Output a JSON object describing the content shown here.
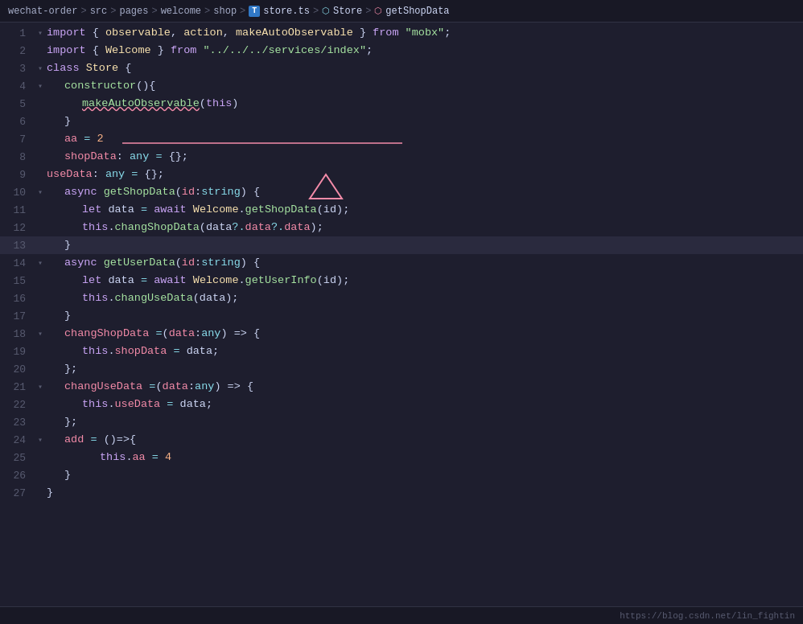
{
  "breadcrumb": {
    "parts": [
      {
        "label": "wechat-order",
        "type": "folder"
      },
      {
        "label": ">",
        "type": "sep"
      },
      {
        "label": "src",
        "type": "folder"
      },
      {
        "label": ">",
        "type": "sep"
      },
      {
        "label": "pages",
        "type": "folder"
      },
      {
        "label": ">",
        "type": "sep"
      },
      {
        "label": "welcome",
        "type": "folder"
      },
      {
        "label": ">",
        "type": "sep"
      },
      {
        "label": "shop",
        "type": "folder"
      },
      {
        "label": ">",
        "type": "sep"
      },
      {
        "label": "store.ts",
        "type": "file-ts"
      },
      {
        "label": ">",
        "type": "sep"
      },
      {
        "label": "Store",
        "type": "class"
      },
      {
        "label": ">",
        "type": "sep"
      },
      {
        "label": "getShopData",
        "type": "method"
      }
    ]
  },
  "status_bar": {
    "url": "https://blog.csdn.net/lin_fightin"
  },
  "lines": [
    {
      "num": 1,
      "collapse": true,
      "indent": 0,
      "html": "<span class='kw'>import</span> <span class='punct'>{ </span><span class='yellow'>observable</span><span class='punct'>, </span><span class='yellow'>action</span><span class='punct'>, </span><span class='yellow'>makeAutoObservable</span><span class='punct'> } </span><span class='kw'>from</span> <span class='str'>\"mobx\"</span><span class='punct'>;</span>"
    },
    {
      "num": 2,
      "collapse": false,
      "indent": 0,
      "html": "<span class='kw'>import</span> <span class='punct'>{ </span><span class='yellow'>Welcome</span><span class='punct'> } </span><span class='kw'>from</span> <span class='str'>\"../../../services/index\"</span><span class='punct'>;</span>"
    },
    {
      "num": 3,
      "collapse": true,
      "indent": 0,
      "html": "<span class='kw'>class</span> <span class='cls'>Store</span> <span class='punct'>{</span>"
    },
    {
      "num": 4,
      "collapse": true,
      "indent": 1,
      "html": "<span class='fn2'>constructor</span><span class='punct'>(){</span>"
    },
    {
      "num": 5,
      "collapse": false,
      "indent": 2,
      "html": "<span class='fn2 red-underline'>makeAutoObservable</span><span class='punct'>(</span><span class='kw'>this</span><span class='punct'>)</span>"
    },
    {
      "num": 6,
      "collapse": false,
      "indent": 1,
      "html": "<span class='punct'>}</span>"
    },
    {
      "num": 7,
      "collapse": false,
      "indent": 1,
      "html": "<span class='prop'>aa</span> <span class='op'>=</span> <span class='num'>2</span>"
    },
    {
      "num": 8,
      "collapse": false,
      "indent": 1,
      "html": "<span class='prop'>shopData</span><span class='punct'>: </span><span class='kw2'>any</span> <span class='op'>=</span> <span class='punct'>{};</span>"
    },
    {
      "num": 9,
      "collapse": false,
      "indent": 0,
      "html": "<span class='prop'>useData</span><span class='punct'>: </span><span class='kw2'>any</span> <span class='op'>=</span> <span class='punct'>{};</span>"
    },
    {
      "num": 10,
      "collapse": true,
      "indent": 1,
      "html": "<span class='kw'>async</span> <span class='fn2'>getShopData</span><span class='punct'>(</span><span class='prop'>id</span><span class='punct'>:</span><span class='kw2'>string</span><span class='punct'>) {</span>"
    },
    {
      "num": 11,
      "collapse": false,
      "indent": 2,
      "html": "<span class='kw'>let</span> <span class='var'>data</span> <span class='op'>=</span> <span class='kw'>await</span> <span class='cls'>Welcome</span><span class='punct'>.</span><span class='fn2'>getShopData</span><span class='punct'>(</span><span class='var'>id</span><span class='punct'>);</span>"
    },
    {
      "num": 12,
      "collapse": false,
      "indent": 2,
      "html": "<span class='kw'>this</span><span class='punct'>.</span><span class='fn2'>changShopData</span><span class='punct'>(</span><span class='var'>data</span><span class='op'>?.</span><span class='prop'>data</span><span class='op'>?.</span><span class='prop'>data</span><span class='punct'>);</span>"
    },
    {
      "num": 13,
      "collapse": false,
      "indent": 1,
      "active": true,
      "html": "<span class='punct'>}</span>"
    },
    {
      "num": 14,
      "collapse": true,
      "indent": 1,
      "html": "<span class='kw'>async</span> <span class='fn2'>getUserData</span><span class='punct'>(</span><span class='prop'>id</span><span class='punct'>:</span><span class='kw2'>string</span><span class='punct'>) {</span>"
    },
    {
      "num": 15,
      "collapse": false,
      "indent": 2,
      "html": "<span class='kw'>let</span> <span class='var'>data</span> <span class='op'>=</span> <span class='kw'>await</span> <span class='cls'>Welcome</span><span class='punct'>.</span><span class='fn2'>getUserInfo</span><span class='punct'>(</span><span class='var'>id</span><span class='punct'>);</span>"
    },
    {
      "num": 16,
      "collapse": false,
      "indent": 2,
      "html": "<span class='kw'>this</span><span class='punct'>.</span><span class='fn2'>changUseData</span><span class='punct'>(</span><span class='var'>data</span><span class='punct'>);</span>"
    },
    {
      "num": 17,
      "collapse": false,
      "indent": 1,
      "html": "<span class='punct'>}</span>"
    },
    {
      "num": 18,
      "collapse": true,
      "indent": 1,
      "html": "<span class='prop'>changShopData</span> <span class='op'>=</span><span class='punct'>(</span><span class='prop'>data</span><span class='punct'>:</span><span class='kw2'>any</span><span class='punct'>) =&gt; {</span>"
    },
    {
      "num": 19,
      "collapse": false,
      "indent": 2,
      "html": "<span class='kw'>this</span><span class='punct'>.</span><span class='prop'>shopData</span> <span class='op'>=</span> <span class='var'>data</span><span class='punct'>;</span>"
    },
    {
      "num": 20,
      "collapse": false,
      "indent": 1,
      "html": "<span class='punct'>};</span>"
    },
    {
      "num": 21,
      "collapse": true,
      "indent": 1,
      "html": "<span class='prop'>changUseData</span> <span class='op'>=</span><span class='punct'>(</span><span class='prop'>data</span><span class='punct'>:</span><span class='kw2'>any</span><span class='punct'>) =&gt; {</span>"
    },
    {
      "num": 22,
      "collapse": false,
      "indent": 2,
      "html": "<span class='kw'>this</span><span class='punct'>.</span><span class='prop'>useData</span> <span class='op'>=</span> <span class='var'>data</span><span class='punct'>;</span>"
    },
    {
      "num": 23,
      "collapse": false,
      "indent": 1,
      "html": "<span class='punct'>};</span>"
    },
    {
      "num": 24,
      "collapse": true,
      "indent": 1,
      "html": "<span class='prop'>add</span> <span class='op'>=</span> <span class='punct'>()=&gt;{</span>"
    },
    {
      "num": 25,
      "collapse": false,
      "indent": 3,
      "html": "<span class='kw'>this</span><span class='punct'>.</span><span class='prop'>aa</span> <span class='op'>=</span> <span class='num'>4</span>"
    },
    {
      "num": 26,
      "collapse": false,
      "indent": 1,
      "html": "<span class='punct'>}</span>"
    },
    {
      "num": 27,
      "collapse": false,
      "indent": 0,
      "html": "<span class='punct'>}</span>"
    }
  ]
}
